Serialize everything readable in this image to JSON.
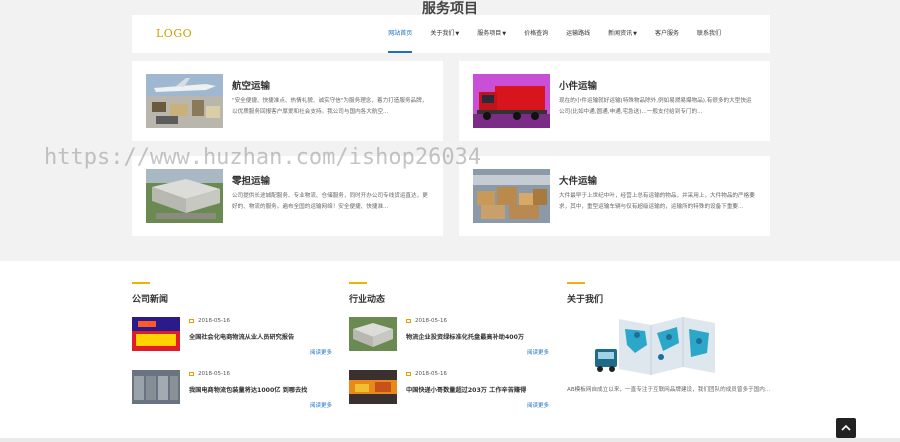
{
  "page_title": "服务项目",
  "logo": "LOGO",
  "nav": [
    {
      "label": "网站首页",
      "active": true,
      "dropdown": false
    },
    {
      "label": "关于我们",
      "active": false,
      "dropdown": true
    },
    {
      "label": "服务项目",
      "active": false,
      "dropdown": true
    },
    {
      "label": "价格查询",
      "active": false,
      "dropdown": false
    },
    {
      "label": "运输路线",
      "active": false,
      "dropdown": false
    },
    {
      "label": "新闻资讯",
      "active": false,
      "dropdown": true
    },
    {
      "label": "客户服务",
      "active": false,
      "dropdown": false
    },
    {
      "label": "联系我们",
      "active": false,
      "dropdown": false
    }
  ],
  "services": [
    {
      "title": "航空运输",
      "desc": "\"安全便捷、快捷准点、热情礼貌、诚实守信\"为服务理念，着力打造服务品牌，以优质服务回报客户厚爱和社会支持。我公司与国内各大航空..."
    },
    {
      "title": "小件运输",
      "desc": "现在的小件运输就好运输(特殊物品除外,例如易燃易爆物品),有很多的大型快运公司(比如中通,圆通,申通,宅急送)...一般支付给到专门的..."
    },
    {
      "title": "零担运输",
      "desc": "公司提供长途城配服务、专业物流、仓储服务，同时开办公司专线货运直达，更好的、物流的服务。遍布全国的运输网络！安全便捷、快捷准..."
    },
    {
      "title": "大件运输",
      "desc": "大件最早于上世纪中叶，经营上总有运输的物品，并采用上，大件物品的严格要求，其中，重型运输车辆与仅有超级运输的，运输所的特殊的设备下重要..."
    }
  ],
  "watermark": "https://www.huzhan.com/ishop26034",
  "company_news": {
    "heading": "公司新闻",
    "items": [
      {
        "date": "2018-05-16",
        "title": "全国社会化电商物流从业人员研究报告",
        "more": "阅读更多"
      },
      {
        "date": "2018-05-16",
        "title": "我国电商物流包装量将达1000亿 到哪去找",
        "more": "阅读更多"
      }
    ]
  },
  "industry_news": {
    "heading": "行业动态",
    "items": [
      {
        "date": "2018-05-16",
        "title": "物流企业投资绿标准化托盘最高补助400万",
        "more": "阅读更多"
      },
      {
        "date": "2018-05-16",
        "title": "中国快递小哥数量超过203万 工作辛苦赚得",
        "more": "阅读更多"
      }
    ]
  },
  "about": {
    "heading": "关于我们",
    "text": "AB模板网自成立以来，一直专注于互联网品牌建设，我们团队的成员曾多于国内..."
  },
  "to_top_icon": "chevron-up-icon",
  "colors": {
    "accent_blue": "#1a6fc2",
    "accent_gold": "#f0b400",
    "logo": "#c9a100"
  }
}
